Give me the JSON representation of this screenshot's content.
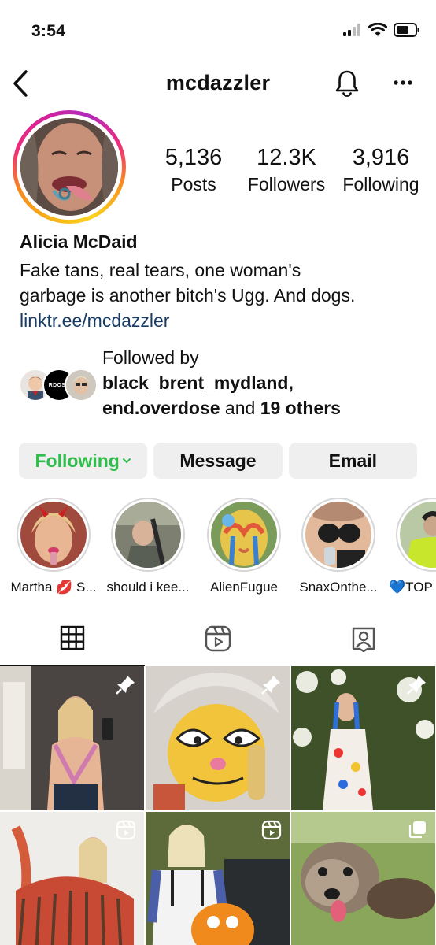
{
  "status_bar": {
    "time": "3:54"
  },
  "nav": {
    "username": "mcdazzler"
  },
  "stats": [
    {
      "value": "5,136",
      "label": "Posts"
    },
    {
      "value": "12.3K",
      "label": "Followers"
    },
    {
      "value": "3,916",
      "label": "Following"
    }
  ],
  "bio": {
    "name": "Alicia McDaid",
    "line1": "Fake tans, real tears, one woman's",
    "line2": "garbage is another bitch's Ugg. And dogs.",
    "link": "linktr.ee/mcdazzler"
  },
  "followed_by": {
    "prefix": "Followed by",
    "user1": "black_brent_mydland,",
    "user2": "end.overdose",
    "middle": " and ",
    "others": "19 others",
    "avatar2_text": "RDOSE"
  },
  "actions": {
    "following": "Following",
    "message": "Message",
    "email": "Email"
  },
  "highlights": [
    {
      "label": "Martha 💋 S..."
    },
    {
      "label": "should i kee..."
    },
    {
      "label": "AlienFugue"
    },
    {
      "label": "SnaxOnthe..."
    },
    {
      "label": "💙TOP"
    }
  ],
  "tabs": [
    {
      "icon": "grid-icon",
      "active": true
    },
    {
      "icon": "reels-icon",
      "active": false
    },
    {
      "icon": "tagged-icon",
      "active": false
    }
  ],
  "colors": {
    "following_green": "#2fbe4b",
    "link_blue": "#183b64",
    "button_gray": "#efefef"
  }
}
